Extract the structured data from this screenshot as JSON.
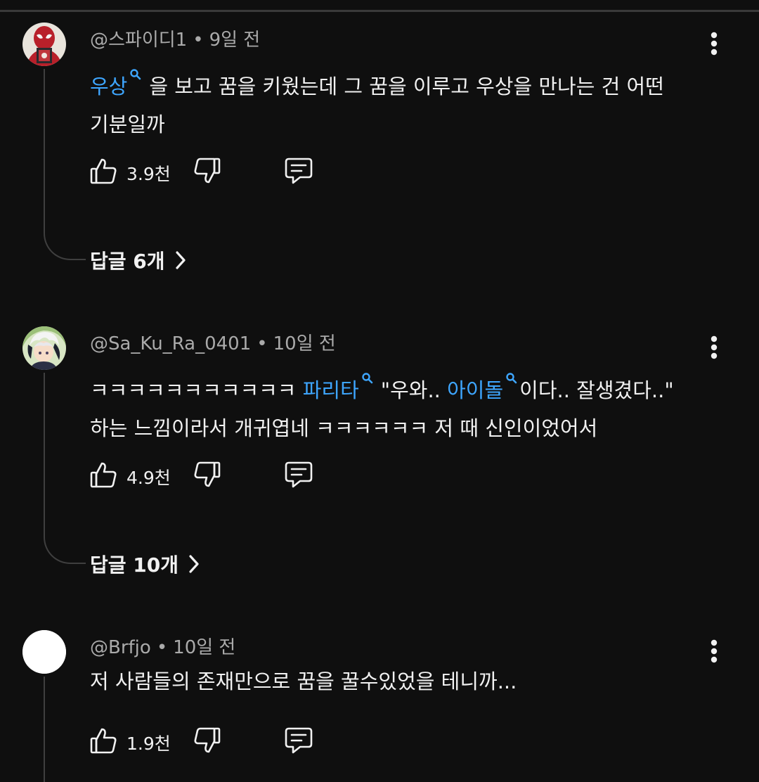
{
  "comments": [
    {
      "handle": "@스파이디1",
      "time": "9일 전",
      "avatar": "spiderman-avatar",
      "line1_kw": "우상",
      "line1_rest": "을 보고 꿈을 키웠는데 그 꿈을 이루고 우상을 만나는 건 어떤",
      "line2": "기분일까",
      "likes": "3.9천",
      "replies_label": "답글 6개"
    },
    {
      "handle": "@Sa_Ku_Ra_0401",
      "time": "10일 전",
      "avatar": "anime-character-avatar",
      "line1_a": "ㅋㅋㅋㅋㅋㅋㅋㅋㅋㅋㅋ",
      "line1_kw1": "파리타",
      "line1_b": "\"우와..",
      "line1_kw2": "아이돌",
      "line1_c": "이다.. 잘생겼다..\"",
      "line2": "하는 느낌이라서 개귀엽네 ㅋㅋㅋㅋㅋㅋ 저 때 신인이었어서",
      "likes": "4.9천",
      "replies_label": "답글 10개"
    },
    {
      "handle": "@Brfjo",
      "time": "10일 전",
      "avatar": "default-white-avatar",
      "line1": "저 사람들의 존재만으로 꿈을 꿀수있었을 테니까...",
      "likes": "1.9천"
    }
  ],
  "separator": "•",
  "colors": {
    "background": "#0f0f0f",
    "primary_text": "#f1f1f1",
    "secondary_text": "#aaaaaa",
    "link": "#3ea6ff",
    "thread_line": "#3f3f3f"
  },
  "icons": [
    "thumbs-up-icon",
    "thumbs-down-icon",
    "reply-icon",
    "more-vert-icon",
    "search-icon",
    "chevron-right-icon"
  ]
}
